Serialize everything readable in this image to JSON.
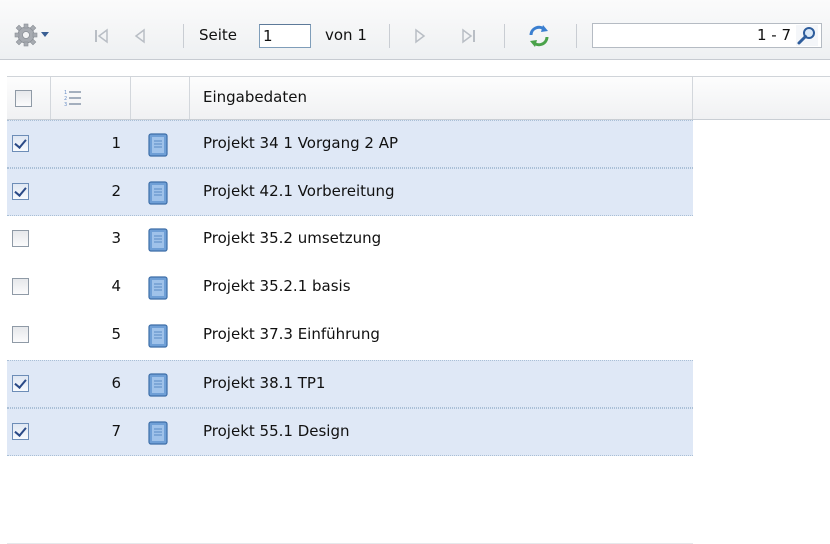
{
  "toolbar": {
    "page_label": "Seite",
    "page_value": "1",
    "of_label": "von 1",
    "range_label": "1 - 7",
    "icons": [
      "gear-icon",
      "first-page-icon",
      "prev-page-icon",
      "next-page-icon",
      "last-page-icon",
      "refresh-icon",
      "search-icon"
    ]
  },
  "grid": {
    "columns": [
      "",
      "",
      "",
      "Eingabedaten"
    ],
    "rows": [
      {
        "num": "1",
        "label": "Projekt 34 1 Vorgang 2 AP",
        "checked": true
      },
      {
        "num": "2",
        "label": "Projekt 42.1 Vorbereitung",
        "checked": true
      },
      {
        "num": "3",
        "label": "Projekt 35.2 umsetzung",
        "checked": false
      },
      {
        "num": "4",
        "label": "Projekt 35.2.1 basis",
        "checked": false
      },
      {
        "num": "5",
        "label": "Projekt 37.3 Einführung",
        "checked": false
      },
      {
        "num": "6",
        "label": "Projekt 38.1 TP1",
        "checked": true
      },
      {
        "num": "7",
        "label": "Projekt 55.1 Design",
        "checked": true
      }
    ]
  },
  "colors": {
    "selected_row": "#dfe8f6",
    "doc_icon": "#5d8fc8"
  }
}
